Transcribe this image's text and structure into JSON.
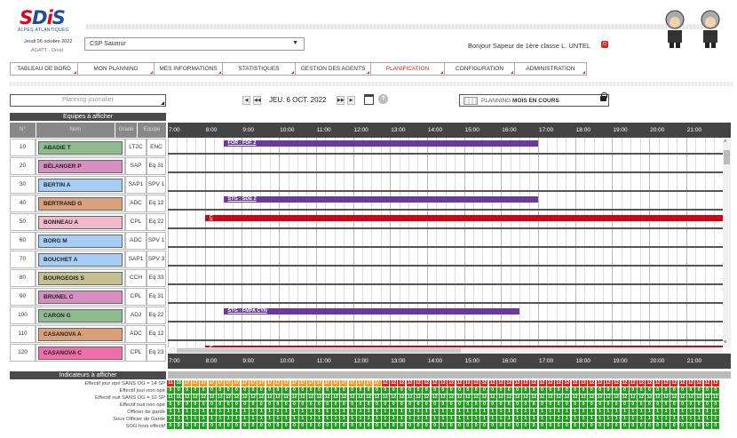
{
  "header": {
    "logo_text": "SDIS",
    "logo_sub": "ALPES-ATLANTIQUES",
    "date": "Jeudi 06 octobre 2022",
    "user_line": "AGATT - Orval",
    "centre": "CSP Saumur",
    "greeting": "Bonjour Sapeur de 1ère classe L. UNTEL"
  },
  "menu": [
    {
      "label": "TABLEAU DE BORD"
    },
    {
      "label": "MON PLANNING"
    },
    {
      "label": "MES INFORMATIONS"
    },
    {
      "label": "STATISTIQUES"
    },
    {
      "label": "GESTION DES AGENTS"
    },
    {
      "label": "PLANIFICATION",
      "active": true
    },
    {
      "label": "CONFIGURATION"
    },
    {
      "label": "ADMINISTRATION"
    }
  ],
  "controls": {
    "planning_select": "Planning journalier",
    "current_date": "JEU. 6 OCT. 2022",
    "planning_period_prefix": "PLANNING",
    "planning_period": "MOIS EN COURS"
  },
  "table": {
    "section_title": "Equipes à afficher",
    "headers": {
      "no": "N°",
      "name": "Nom",
      "grade": "Grade",
      "equipe": "Equipe"
    },
    "rows": [
      {
        "no": "10",
        "name": "ABADIE T",
        "grade": "LT2C",
        "equipe": "ENC",
        "color": "#8fbc8f"
      },
      {
        "no": "20",
        "name": "BÉLANGER P",
        "grade": "SAP",
        "equipe": "Eq 31",
        "color": "#d68fc0"
      },
      {
        "no": "30",
        "name": "BERTIN A",
        "grade": "SAP1",
        "equipe": "SPV 1",
        "color": "#a6cdf5"
      },
      {
        "no": "40",
        "name": "BERTRAND G",
        "grade": "ADC",
        "equipe": "Eq 12",
        "color": "#d9a07a"
      },
      {
        "no": "50",
        "name": "BONNEAU A",
        "grade": "CPL",
        "equipe": "Eq 22",
        "color": "#f2b8cc"
      },
      {
        "no": "60",
        "name": "BORG M",
        "grade": "ADC",
        "equipe": "SPV 1",
        "color": "#a6cdf5"
      },
      {
        "no": "70",
        "name": "BOUCHET A",
        "grade": "SAP1",
        "equipe": "SPV 3",
        "color": "#a6cdf5"
      },
      {
        "no": "80",
        "name": "BOURGEOIS S",
        "grade": "CCH",
        "equipe": "Eq 33",
        "color": "#c4c091"
      },
      {
        "no": "90",
        "name": "BRUNEL C",
        "grade": "CPL",
        "equipe": "Eq 31",
        "color": "#d68fc0"
      },
      {
        "no": "100",
        "name": "CARON G",
        "grade": "ADJ",
        "equipe": "Eq 22",
        "color": "#8fbc8f"
      },
      {
        "no": "110",
        "name": "CASANOVA A",
        "grade": "ADC",
        "equipe": "Eq 12",
        "color": "#d9a07a"
      },
      {
        "no": "120",
        "name": "CASANOVA C",
        "grade": "CPL",
        "equipe": "Eq 23",
        "color": "#ef6fa8"
      }
    ]
  },
  "timeline": {
    "hours": [
      "7:00",
      "8:00",
      "9:00",
      "10:00",
      "11:00",
      "12:00",
      "13:00",
      "14:00",
      "15:00",
      "16:00",
      "17:00",
      "18:00",
      "19:00",
      "20:00",
      "21:00"
    ],
    "bars": [
      {
        "row": 0,
        "start": 8.5,
        "end": 17,
        "label": "FOR : FDF 2",
        "color": "#6a3a9e"
      },
      {
        "row": 3,
        "start": 8.5,
        "end": 17,
        "label": "STG : SDE 2",
        "color": "#6a3a9e"
      },
      {
        "row": 4,
        "start": 8,
        "end": 22,
        "label": "C",
        "color": "#c8081a"
      },
      {
        "row": 9,
        "start": 8.5,
        "end": 16.5,
        "label": "STG : FMPA CYN",
        "color": "#6a3a9e"
      },
      {
        "row": 11,
        "start": 8,
        "end": 22,
        "label": "C",
        "color": "#c8081a"
      }
    ]
  },
  "indicators": {
    "section_title": "Indicateurs à afficher",
    "rows": [
      {
        "label": "Effectif jour opé SANS OG = 14 SP",
        "values": [
          "11",
          "16",
          "17",
          "17",
          "17",
          "17",
          "17",
          "17",
          "17",
          "17",
          "17",
          "17",
          "17",
          "17",
          "17",
          "17",
          "17",
          "17",
          "17",
          "17",
          "17",
          "17",
          "17",
          "17",
          "17",
          "17",
          "12",
          "12",
          "12",
          "12",
          "12",
          "12",
          "12",
          "12",
          "12",
          "12",
          "12",
          "12",
          "12",
          "12",
          "12",
          "12",
          "12",
          "12",
          "12",
          "12",
          "12",
          "12",
          "12",
          "12",
          "12",
          "12",
          "12",
          "12",
          "12",
          "12",
          "12",
          "12",
          "12",
          "12",
          "12",
          "12",
          "12",
          "12",
          "12",
          "12",
          "12"
        ]
      },
      {
        "label": "Effectif jour non opé",
        "values": [
          "0",
          "0",
          "0",
          "0",
          "0",
          "0",
          "0",
          "0",
          "0",
          "0",
          "0",
          "0",
          "0",
          "0",
          "0",
          "0",
          "0",
          "0",
          "0",
          "0",
          "0",
          "0",
          "0",
          "0",
          "0",
          "0",
          "0",
          "0",
          "0",
          "0",
          "0",
          "0",
          "0",
          "0",
          "0",
          "0",
          "0",
          "0",
          "0",
          "0",
          "0",
          "0",
          "0",
          "0",
          "0",
          "0",
          "0",
          "0",
          "0",
          "0",
          "0",
          "0",
          "0",
          "0",
          "0",
          "0",
          "0",
          "0",
          "0",
          "0",
          "0",
          "0",
          "0",
          "0",
          "0",
          "0",
          "0"
        ]
      },
      {
        "label": "Effectif nuit SANS OG = 10 SP",
        "values": [
          "11",
          "11",
          "12",
          "12",
          "12",
          "12",
          "12",
          "12",
          "12",
          "12",
          "12",
          "12",
          "12",
          "12",
          "12",
          "12",
          "12",
          "12",
          "12",
          "12",
          "12",
          "12",
          "12",
          "12",
          "12",
          "12",
          "12",
          "12",
          "12",
          "12",
          "12",
          "12",
          "12",
          "12",
          "12",
          "12",
          "12",
          "12",
          "12",
          "12",
          "12",
          "12",
          "12",
          "12",
          "12",
          "12",
          "12",
          "12",
          "12",
          "12",
          "12",
          "12",
          "12",
          "12",
          "12",
          "12",
          "12",
          "12",
          "12",
          "12",
          "12",
          "12",
          "12",
          "12",
          "12",
          "12",
          "12"
        ]
      },
      {
        "label": "Effectif nuit non opé",
        "values": [
          "0",
          "0",
          "0",
          "0",
          "0",
          "0",
          "0",
          "0",
          "0",
          "0",
          "0",
          "0",
          "0",
          "0",
          "0",
          "0",
          "0",
          "0",
          "0",
          "0",
          "0",
          "0",
          "0",
          "0",
          "0",
          "0",
          "0",
          "0",
          "0",
          "0",
          "0",
          "0",
          "0",
          "0",
          "0",
          "0",
          "0",
          "0",
          "0",
          "0",
          "0",
          "0",
          "0",
          "0",
          "0",
          "0",
          "0",
          "0",
          "0",
          "0",
          "0",
          "0",
          "0",
          "0",
          "0",
          "0",
          "0",
          "0",
          "0",
          "0",
          "0",
          "0",
          "0",
          "0",
          "0",
          "0",
          "0"
        ]
      },
      {
        "label": "Officier de garde",
        "values": [
          "1",
          "1",
          "1",
          "1",
          "1",
          "1",
          "1",
          "1",
          "1",
          "1",
          "1",
          "1",
          "1",
          "1",
          "1",
          "1",
          "1",
          "1",
          "1",
          "1",
          "1",
          "1",
          "1",
          "1",
          "1",
          "1",
          "1",
          "1",
          "1",
          "1",
          "1",
          "1",
          "1",
          "1",
          "1",
          "1",
          "1",
          "1",
          "1",
          "1",
          "1",
          "1",
          "1",
          "1",
          "1",
          "1",
          "1",
          "1",
          "1",
          "1",
          "1",
          "1",
          "1",
          "1",
          "1",
          "1",
          "1",
          "1",
          "1",
          "1",
          "1",
          "1",
          "1",
          "1",
          "1",
          "1",
          "1"
        ]
      },
      {
        "label": "Sous Officier de Garde",
        "values": [
          "1",
          "1",
          "1",
          "1",
          "1",
          "1",
          "1",
          "1",
          "1",
          "1",
          "1",
          "1",
          "1",
          "1",
          "1",
          "1",
          "1",
          "1",
          "1",
          "1",
          "1",
          "1",
          "1",
          "1",
          "1",
          "1",
          "1",
          "1",
          "1",
          "1",
          "1",
          "1",
          "1",
          "1",
          "1",
          "1",
          "1",
          "1",
          "1",
          "1",
          "1",
          "1",
          "1",
          "1",
          "1",
          "1",
          "1",
          "1",
          "1",
          "1",
          "1",
          "1",
          "1",
          "1",
          "1",
          "1",
          "1",
          "1",
          "1",
          "1",
          "1",
          "1",
          "1",
          "1",
          "1",
          "1",
          "1"
        ]
      },
      {
        "label": "SOG hors effectif",
        "values": [
          "0",
          "0",
          "0",
          "0",
          "0",
          "0",
          "0",
          "0",
          "0",
          "0",
          "0",
          "0",
          "0",
          "0",
          "0",
          "0",
          "0",
          "0",
          "0",
          "0",
          "0",
          "0",
          "0",
          "0",
          "0",
          "0",
          "0",
          "0",
          "0",
          "0",
          "0",
          "0",
          "0",
          "0",
          "0",
          "0",
          "0",
          "0",
          "0",
          "0",
          "0",
          "0",
          "0",
          "0",
          "0",
          "0",
          "0",
          "0",
          "0",
          "0",
          "0",
          "0",
          "0",
          "0",
          "0",
          "0",
          "0",
          "0",
          "0",
          "0",
          "0",
          "0",
          "0",
          "0",
          "0",
          "0",
          "0"
        ]
      }
    ]
  },
  "colors": {
    "accent": "#d9261c",
    "ok": "#22a020",
    "warn": "#f0a020",
    "alert": "#d9261c"
  }
}
